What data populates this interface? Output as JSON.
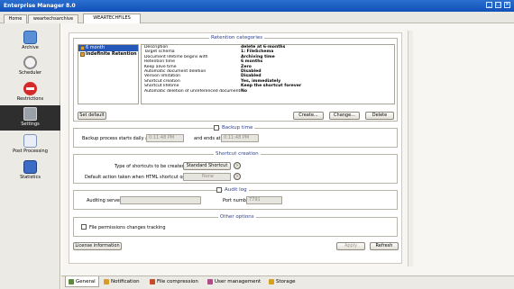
{
  "window": {
    "title": "Enterprise Manager 8.0"
  },
  "top_tabs": [
    "Home",
    "weartechsarchive",
    "WEARTECHFILES"
  ],
  "sidebar": {
    "items": [
      {
        "label": "Archive",
        "icon": "archive-icon"
      },
      {
        "label": "Scheduler",
        "icon": "clock-icon"
      },
      {
        "label": "Restrictions",
        "icon": "no-entry-icon"
      },
      {
        "label": "Settings",
        "icon": "settings-icon"
      },
      {
        "label": "Post Processing",
        "icon": "post-processing-icon"
      },
      {
        "label": "Statistics",
        "icon": "statistics-icon"
      }
    ]
  },
  "retention": {
    "title": "Retention categories",
    "categories": [
      "6 month",
      "Indefinite Retention"
    ],
    "details": [
      {
        "k": "Description",
        "v": "delete at 6-months"
      },
      {
        "k": "Target schema",
        "v": "1: FileSchema"
      },
      {
        "k": "Document lifetime begins with",
        "v": "Archiving time"
      },
      {
        "k": "Retention time",
        "v": "6 months"
      },
      {
        "k": "Keep alive time",
        "v": "Zero"
      },
      {
        "k": "Automatic document deletion",
        "v": "Disabled"
      },
      {
        "k": "Version limitation",
        "v": "Disabled"
      },
      {
        "k": "Shortcut creation",
        "v": "Yes, immediately"
      },
      {
        "k": "Shortcut lifetime",
        "v": "Keep the shortcut forever"
      },
      {
        "k": "Automatic deletion of unreferenced documents",
        "v": "No"
      }
    ],
    "set_default": "Set default",
    "create": "Create...",
    "change": "Change...",
    "delete": "Delete"
  },
  "backup": {
    "title": "Backup time",
    "starts_label": "Backup process starts daily at",
    "start_value": "0:11:48 PM",
    "ends_label": "and ends at",
    "end_value": "0:11:48 PM"
  },
  "shortcut": {
    "title": "Shortcut creation",
    "type_label": "Type of shortcuts to be created",
    "type_value": "Standard Shortcut",
    "default_action_label": "Default action taken when HTML shortcut opened",
    "default_action_value": "None"
  },
  "audit": {
    "title": "Audit log",
    "server_label": "Auditing server",
    "server_value": "",
    "port_label": "Port number",
    "port_value": "7791"
  },
  "other": {
    "title": "Other options",
    "file_permissions": "File permissions changes tracking"
  },
  "bottom_buttons": {
    "license": "License information",
    "apply": "Apply",
    "refresh": "Refresh"
  },
  "bottom_tabs": [
    "General",
    "Notification",
    "File compression",
    "User management",
    "Storage"
  ],
  "colors": {
    "titlebar": "#1a5cc4",
    "selection": "#2457b8",
    "section_title": "#2c3f8a"
  }
}
